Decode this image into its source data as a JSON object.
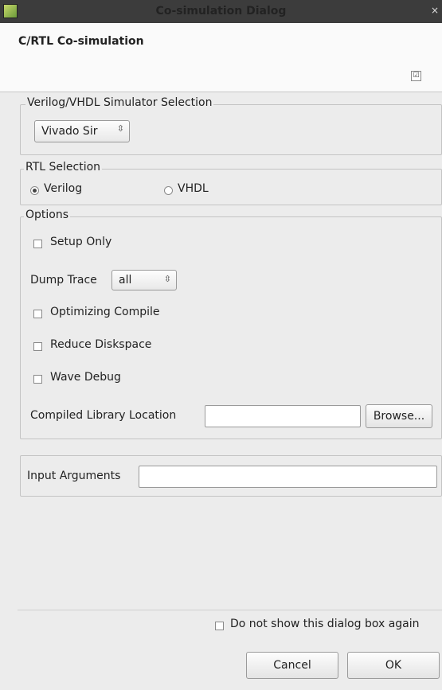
{
  "window": {
    "title": "Co-simulation Dialog",
    "close_glyph": "×"
  },
  "header": {
    "title": "C/RTL Co-simulation",
    "check_glyph": "☑"
  },
  "simulator": {
    "legend": "Verilog/VHDL Simulator Selection",
    "selected": "Vivado Sir",
    "arrow": "⇳"
  },
  "rtl": {
    "legend": "RTL Selection",
    "verilog_label": "Verilog",
    "vhdl_label": "VHDL",
    "selected": "Verilog"
  },
  "options": {
    "legend": "Options",
    "setup_only": "Setup Only",
    "dump_trace_label": "Dump Trace",
    "dump_trace_value": "all",
    "optimizing_compile": "Optimizing Compile",
    "reduce_diskspace": "Reduce Diskspace",
    "wave_debug": "Wave Debug",
    "compiled_library_label": "Compiled Library Location",
    "compiled_library_value": "",
    "browse_label": "Browse..."
  },
  "input_arguments": {
    "label": "Input Arguments",
    "value": ""
  },
  "footer": {
    "do_not_show_label": "Do not show this dialog box again",
    "cancel_label": "Cancel",
    "ok_label": "OK"
  }
}
